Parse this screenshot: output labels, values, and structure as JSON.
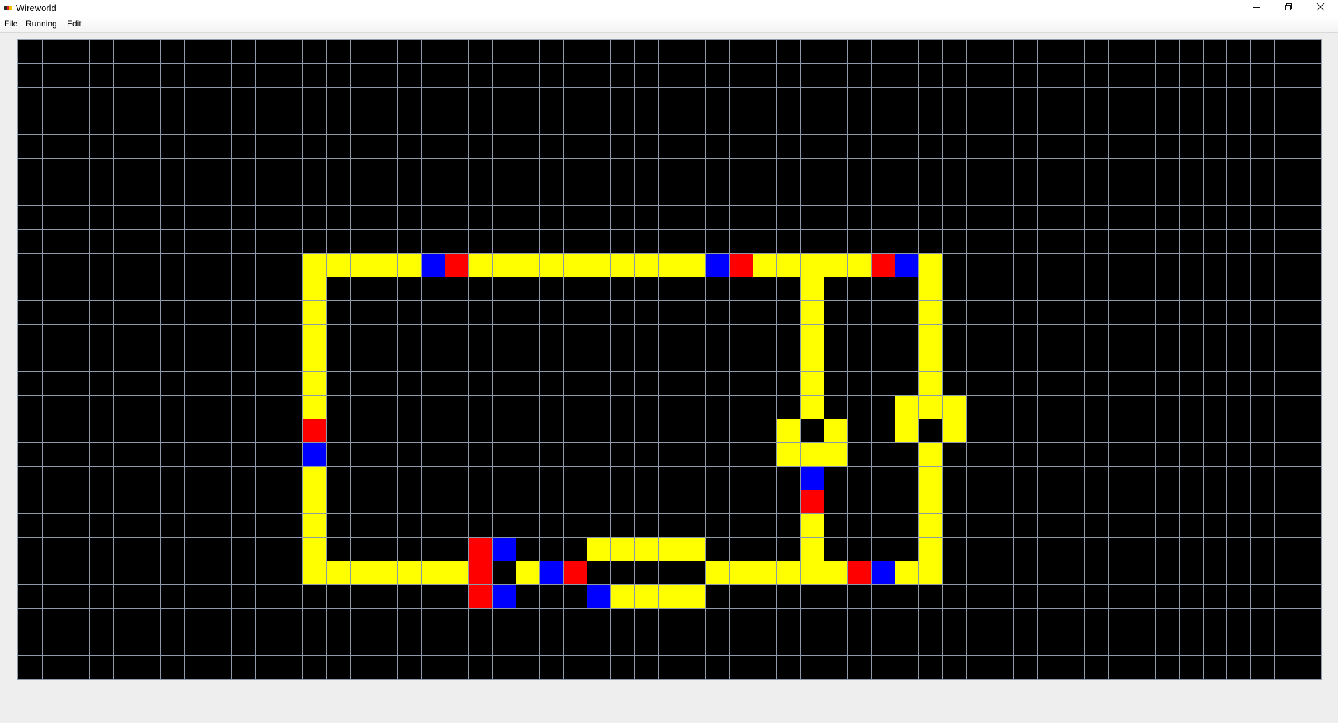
{
  "window": {
    "title": "Wireworld",
    "icon": "wireworld-app-icon",
    "controls": {
      "minimize": "minimize-icon",
      "restore": "restore-icon",
      "close": "close-icon"
    }
  },
  "menu": {
    "items": [
      "File",
      "Running",
      "Edit"
    ]
  },
  "board": {
    "cols": 55,
    "rows": 27,
    "colors": {
      "empty": "#000000",
      "grid": "#8e9aaa",
      "conductor": "#ffff00",
      "head": "#0000ff",
      "tail": "#ff0000"
    },
    "cells": {
      "conductor": [
        [
          12,
          9
        ],
        [
          13,
          9
        ],
        [
          14,
          9
        ],
        [
          15,
          9
        ],
        [
          16,
          9
        ],
        [
          19,
          9
        ],
        [
          20,
          9
        ],
        [
          21,
          9
        ],
        [
          22,
          9
        ],
        [
          23,
          9
        ],
        [
          24,
          9
        ],
        [
          25,
          9
        ],
        [
          26,
          9
        ],
        [
          27,
          9
        ],
        [
          28,
          9
        ],
        [
          31,
          9
        ],
        [
          32,
          9
        ],
        [
          33,
          9
        ],
        [
          34,
          9
        ],
        [
          35,
          9
        ],
        [
          38,
          9
        ],
        [
          12,
          10
        ],
        [
          12,
          11
        ],
        [
          12,
          12
        ],
        [
          12,
          13
        ],
        [
          12,
          14
        ],
        [
          12,
          15
        ],
        [
          12,
          18
        ],
        [
          12,
          19
        ],
        [
          12,
          20
        ],
        [
          12,
          21
        ],
        [
          12,
          22
        ],
        [
          13,
          22
        ],
        [
          14,
          22
        ],
        [
          15,
          22
        ],
        [
          16,
          22
        ],
        [
          17,
          22
        ],
        [
          18,
          22
        ],
        [
          33,
          10
        ],
        [
          33,
          11
        ],
        [
          33,
          12
        ],
        [
          33,
          13
        ],
        [
          33,
          14
        ],
        [
          33,
          15
        ],
        [
          32,
          16
        ],
        [
          34,
          16
        ],
        [
          32,
          17
        ],
        [
          33,
          17
        ],
        [
          34,
          17
        ],
        [
          33,
          20
        ],
        [
          33,
          21
        ],
        [
          38,
          10
        ],
        [
          38,
          11
        ],
        [
          38,
          12
        ],
        [
          38,
          13
        ],
        [
          38,
          14
        ],
        [
          38,
          15
        ],
        [
          37,
          15
        ],
        [
          39,
          15
        ],
        [
          37,
          16
        ],
        [
          39,
          16
        ],
        [
          38,
          17
        ],
        [
          38,
          18
        ],
        [
          38,
          19
        ],
        [
          38,
          20
        ],
        [
          38,
          21
        ],
        [
          38,
          22
        ],
        [
          21,
          22
        ],
        [
          24,
          21
        ],
        [
          25,
          21
        ],
        [
          26,
          21
        ],
        [
          27,
          21
        ],
        [
          28,
          21
        ],
        [
          25,
          23
        ],
        [
          26,
          23
        ],
        [
          27,
          23
        ],
        [
          28,
          23
        ],
        [
          29,
          22
        ],
        [
          30,
          22
        ],
        [
          31,
          22
        ],
        [
          32,
          22
        ],
        [
          33,
          22
        ],
        [
          34,
          22
        ],
        [
          37,
          22
        ]
      ],
      "head": [
        [
          17,
          9
        ],
        [
          29,
          9
        ],
        [
          37,
          9
        ],
        [
          12,
          17
        ],
        [
          20,
          21
        ],
        [
          20,
          23
        ],
        [
          22,
          22
        ],
        [
          24,
          23
        ],
        [
          33,
          18
        ],
        [
          36,
          22
        ]
      ],
      "tail": [
        [
          18,
          9
        ],
        [
          30,
          9
        ],
        [
          36,
          9
        ],
        [
          12,
          16
        ],
        [
          19,
          21
        ],
        [
          19,
          22
        ],
        [
          19,
          23
        ],
        [
          23,
          22
        ],
        [
          33,
          19
        ],
        [
          35,
          22
        ]
      ]
    }
  }
}
